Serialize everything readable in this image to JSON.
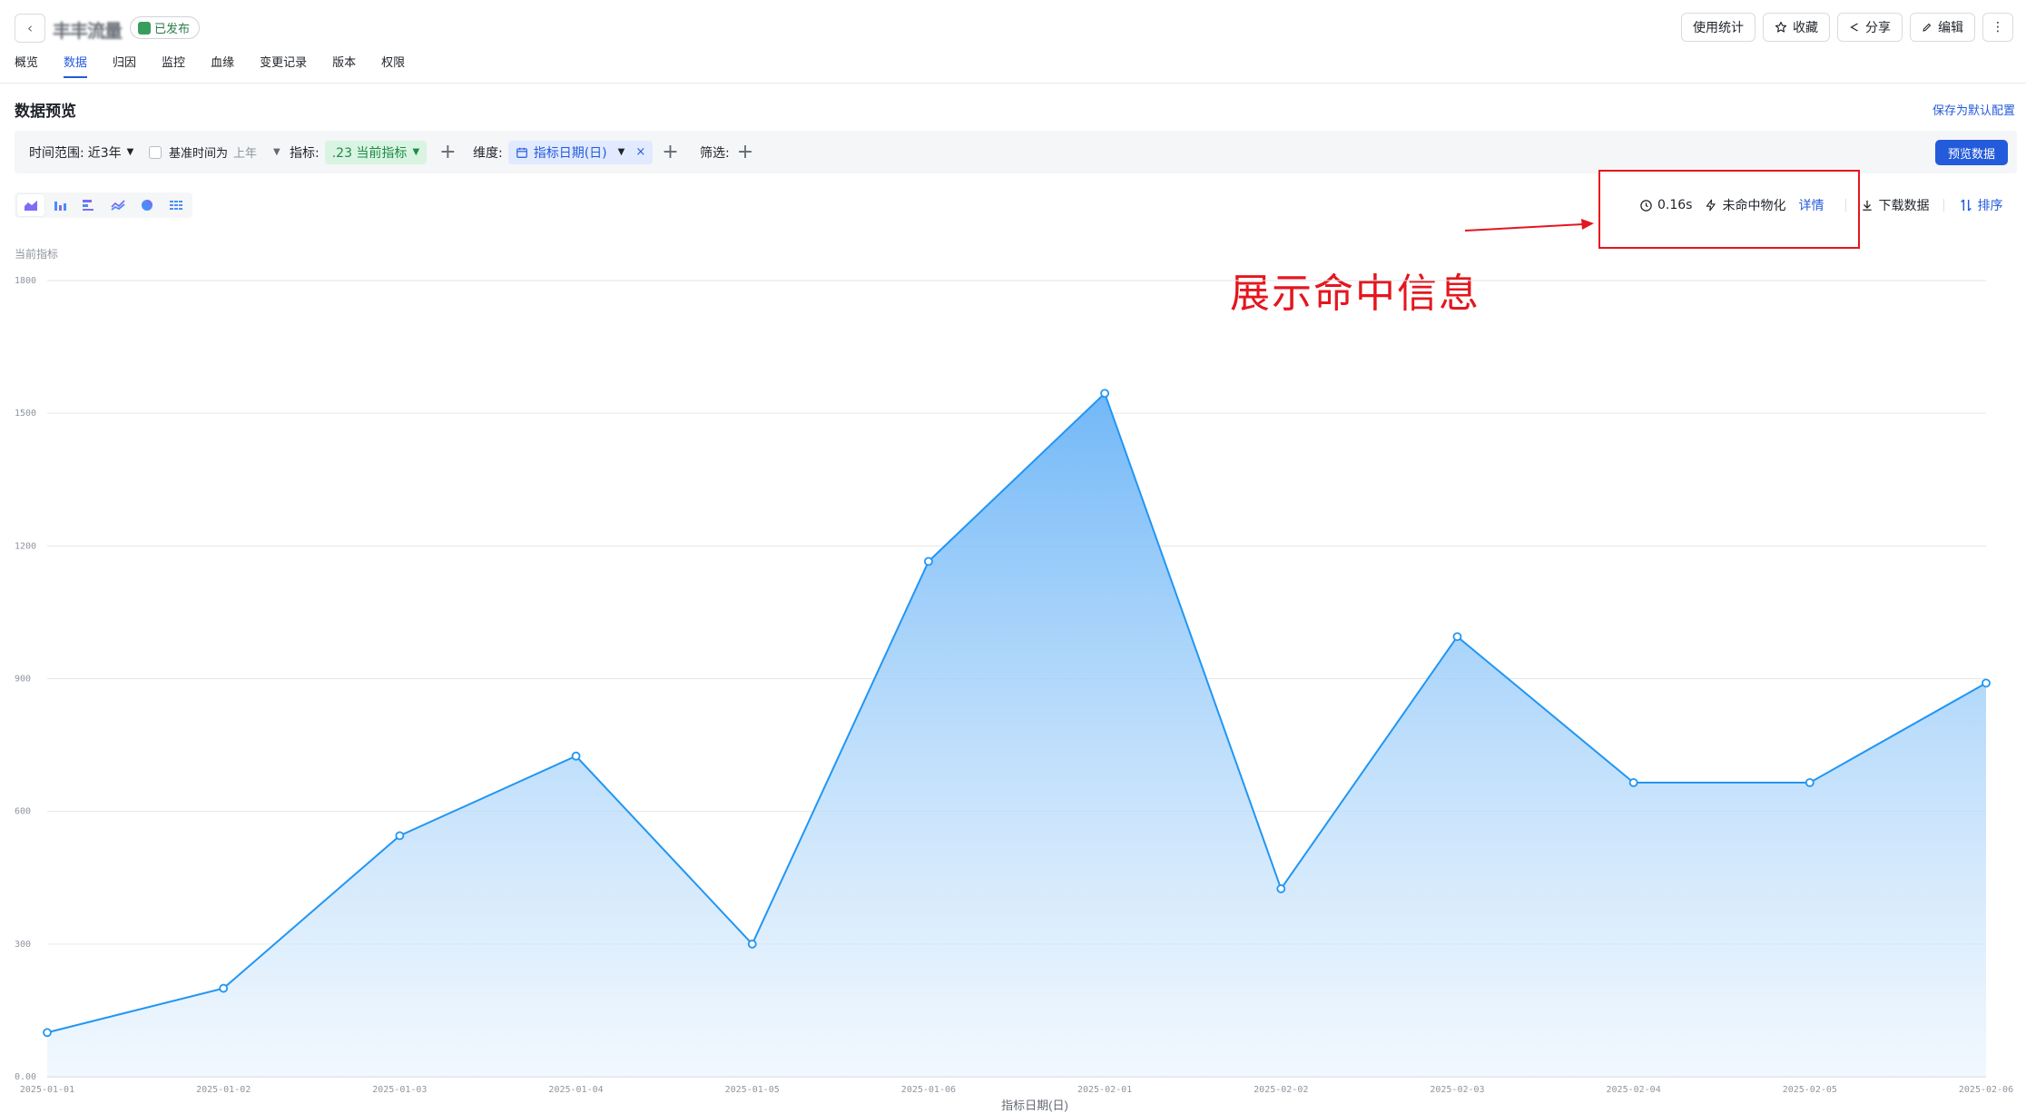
{
  "header": {
    "title": "丰丰流量",
    "status": "已发布",
    "actions": {
      "usage": "使用统计",
      "favorite": "收藏",
      "share": "分享",
      "edit": "编辑"
    },
    "tabs": [
      "概览",
      "数据",
      "归因",
      "监控",
      "血缘",
      "变更记录",
      "版本",
      "权限"
    ],
    "active_tab": 1
  },
  "section": {
    "title": "数据预览",
    "save_default": "保存为默认配置"
  },
  "filters": {
    "time_range_label": "时间范围:",
    "time_range_value": "近3年",
    "baseline_label": "基准时间为",
    "baseline_value": "上年",
    "metric_label": "指标:",
    "metric_value": ".23 当前指标",
    "dimension_label": "维度:",
    "dimension_value": "指标日期(日)",
    "filter_label": "筛选:",
    "preview_button": "预览数据"
  },
  "query_info": {
    "duration": "0.16s",
    "materialization": "未命中物化",
    "detail_link": "详情",
    "download": "下载数据",
    "sort": "排序"
  },
  "annotation": {
    "text": "展示命中信息"
  },
  "colors": {
    "accent": "#245bdb",
    "series": "#2196f3",
    "annotation": "#e4161e"
  },
  "chart_data": {
    "type": "area",
    "ylabel": "当前指标",
    "xlabel": "指标日期(日)",
    "x": [
      "2025-01-01",
      "2025-01-02",
      "2025-01-03",
      "2025-01-04",
      "2025-01-05",
      "2025-01-06",
      "2025-02-01",
      "2025-02-02",
      "2025-02-03",
      "2025-02-04",
      "2025-02-05",
      "2025-02-06"
    ],
    "values": [
      100,
      200,
      545,
      725,
      300,
      1165,
      1545,
      425,
      995,
      665,
      665,
      890
    ],
    "y_ticks": [
      "0.00",
      "300",
      "600",
      "900",
      "1200",
      "1500",
      "1800"
    ],
    "ylim": [
      0,
      1800
    ],
    "grid": true
  }
}
